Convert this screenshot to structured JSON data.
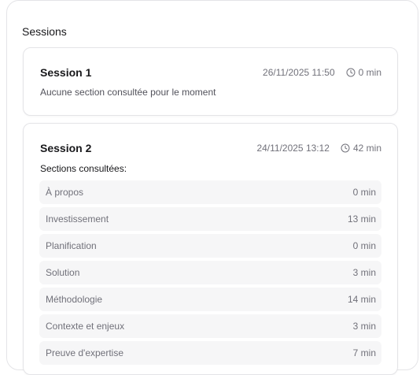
{
  "sessions_heading": "Sessions",
  "sessions": [
    {
      "title": "Session 1",
      "date": "26/11/2025 11:50",
      "duration": "0 min",
      "description": "Aucune section consultée pour le moment"
    },
    {
      "title": "Session 2",
      "date": "24/11/2025 13:12",
      "duration": "42 min",
      "subheading": "Sections consultées:",
      "sections": [
        {
          "name": "À propos",
          "duration": "0 min"
        },
        {
          "name": "Investissement",
          "duration": "13 min"
        },
        {
          "name": "Planification",
          "duration": "0 min"
        },
        {
          "name": "Solution",
          "duration": "3 min"
        },
        {
          "name": "Méthodologie",
          "duration": "14 min"
        },
        {
          "name": "Contexte et enjeux",
          "duration": "3 min"
        },
        {
          "name": "Preuve d'expertise",
          "duration": "7 min"
        }
      ]
    }
  ],
  "icons": {
    "duration": "clock-icon"
  },
  "colors": {
    "border": "#e4e4e7",
    "row_bg": "#f6f6f7",
    "muted_text": "#71717a"
  }
}
